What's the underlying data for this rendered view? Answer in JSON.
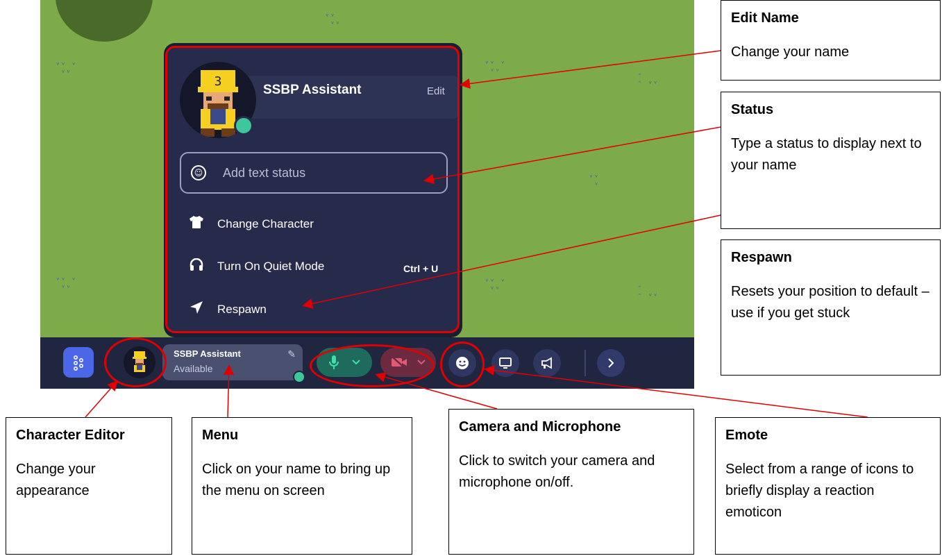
{
  "menu": {
    "user_name": "SSBP Assistant",
    "edit_label": "Edit",
    "status_placeholder": "Add text status",
    "items": [
      {
        "label": "Change Character",
        "icon": "shirt-icon"
      },
      {
        "label": "Turn On Quiet Mode",
        "icon": "headphones-icon",
        "shortcut": "Ctrl + U"
      },
      {
        "label": "Respawn",
        "icon": "navigation-arrow-icon"
      }
    ]
  },
  "toolbar": {
    "name": "SSBP Assistant",
    "availability": "Available",
    "icons": [
      "grid-dots-icon",
      "avatar",
      "pencil-icon",
      "microphone-icon",
      "chevron-down-icon",
      "camera-off-icon",
      "smile-icon",
      "monitor-icon",
      "megaphone-icon",
      "chevron-right-icon"
    ]
  },
  "callouts": {
    "edit_name": {
      "title": "Edit Name",
      "desc": "Change your name"
    },
    "status": {
      "title": "Status",
      "desc": "Type a status to display next to your name"
    },
    "respawn": {
      "title": "Respawn",
      "desc": "Resets your position to default – use if you get stuck"
    },
    "character_editor": {
      "title": "Character Editor",
      "desc": "Change your appearance"
    },
    "menu": {
      "title": "Menu",
      "desc": "Click on your name to bring up the menu on screen"
    },
    "camera_mic": {
      "title": "Camera and Microphone",
      "desc": "Click to switch your camera and microphone on/off."
    },
    "emote": {
      "title": "Emote",
      "desc": "Select from a range of icons to briefly display a reaction emoticon"
    }
  },
  "colors": {
    "grass": "#7eab4a",
    "toolbar": "#202540",
    "menu_bg": "#262b4b",
    "highlight": "#e00000",
    "online": "#3ec79a",
    "accent": "#4c66e8"
  }
}
